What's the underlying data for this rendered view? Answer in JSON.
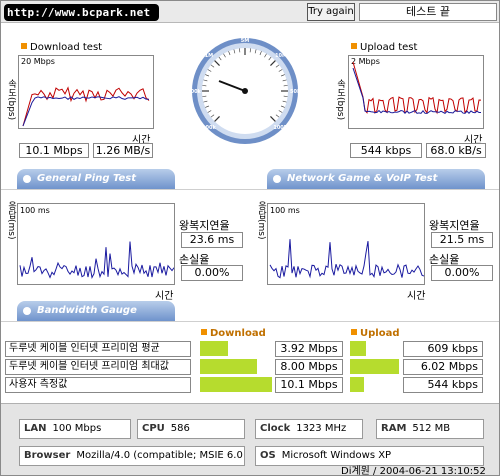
{
  "header": {
    "url": "http://www.bcpark.net",
    "try_again_label": "Try again",
    "status": "테스트 끝"
  },
  "download": {
    "title": "Download test",
    "ylabel": "속도(bps)",
    "scale": "20 Mbps",
    "xlabel": "시간",
    "value_mbps": "10.1 Mbps",
    "value_mb_s": "1.26 MB/s"
  },
  "upload": {
    "title": "Upload test",
    "ylabel": "속도(bps)",
    "scale": "2 Mbps",
    "xlabel": "시간",
    "value_kbps": "544 kbps",
    "value_kb_s": "68.0 kB/s"
  },
  "gauge": {
    "ticks": [
      "100k",
      "500k",
      "1M",
      "5M",
      "10M",
      "50M",
      "100M"
    ]
  },
  "ping": {
    "tab_label": "General Ping Test",
    "ylabel": "응답(ms)",
    "scale": "100 ms",
    "xlabel": "시간",
    "rtt_label": "왕복지연율",
    "rtt_value": "23.6 ms",
    "loss_label": "손실율",
    "loss_value": "0.00%"
  },
  "game": {
    "tab_label": "Network Game & VoIP Test",
    "ylabel": "응답(ms)",
    "scale": "100 ms",
    "xlabel": "시간",
    "rtt_label": "왕복지연율",
    "rtt_value": "21.5 ms",
    "loss_label": "손실율",
    "loss_value": "0.00%"
  },
  "bandwidth": {
    "tab_label": "Bandwidth Gauge",
    "download_header": "Download",
    "upload_header": "Upload",
    "rows": [
      {
        "label": "두루넷 케이블 인터넷 프리미엄 평균",
        "download": "3.92 Mbps",
        "download_fill": 0.39,
        "upload": "609 kbps",
        "upload_fill": 0.31
      },
      {
        "label": "두루넷 케이블 인터넷 프리미엄 최대값",
        "download": "8.00 Mbps",
        "download_fill": 0.79,
        "upload": "6.02 Mbps",
        "upload_fill": 0.97
      },
      {
        "label": "사용자 측정값",
        "download": "10.1 Mbps",
        "download_fill": 1.0,
        "upload": "544 kbps",
        "upload_fill": 0.29
      }
    ]
  },
  "system": {
    "lan_label": "LAN",
    "lan_value": "100 Mbps",
    "cpu_label": "CPU",
    "cpu_value": "586",
    "clock_label": "Clock",
    "clock_value": "1323 MHz",
    "ram_label": "RAM",
    "ram_value": "512 MB",
    "browser_label": "Browser",
    "browser_value": "Mozilla/4.0 (compatible; MSIE 6.0",
    "os_label": "OS",
    "os_value": "Microsoft Windows XP"
  },
  "footer": {
    "text": "Di계원 / 2004-06-21 13:10:52"
  },
  "colors": {
    "accent_orange": "#f09000",
    "tab_blue": "#6f93cc",
    "bar_green": "#b6dc2e",
    "download_series_1": "#c00000",
    "download_series_2": "#1a1a9a"
  }
}
